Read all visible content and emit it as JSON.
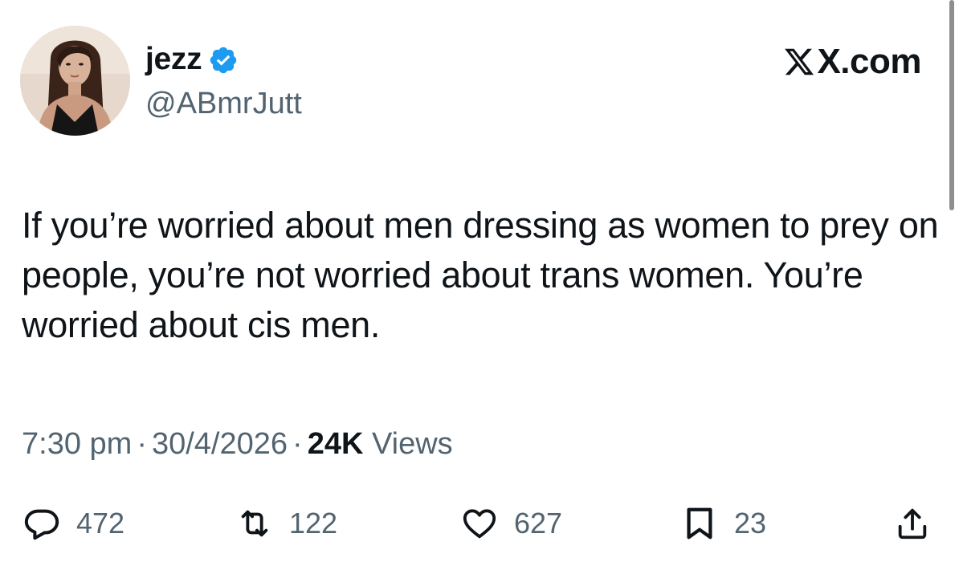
{
  "author": {
    "display_name": "jezz",
    "handle": "@ABmrJutt",
    "verified": true,
    "avatar_icon": "profile-photo"
  },
  "brand": {
    "label": "X.com",
    "icon": "x-logo-icon"
  },
  "tweet": {
    "text": "If you’re worried about men dressing as women to prey on people, you’re not worried about trans women. You’re worried about cis men."
  },
  "meta": {
    "time": "7:30 pm",
    "date": "30/4/2026",
    "separator": "·",
    "views_count": "24K",
    "views_label": "Views"
  },
  "actions": {
    "reply": {
      "icon": "reply-icon",
      "count": "472"
    },
    "repost": {
      "icon": "repost-icon",
      "count": "122"
    },
    "like": {
      "icon": "heart-icon",
      "count": "627"
    },
    "bookmark": {
      "icon": "bookmark-icon",
      "count": "23"
    },
    "share": {
      "icon": "share-icon"
    }
  },
  "colors": {
    "text_primary": "#0f1419",
    "text_secondary": "#536471",
    "verified_blue": "#1d9bf0"
  }
}
